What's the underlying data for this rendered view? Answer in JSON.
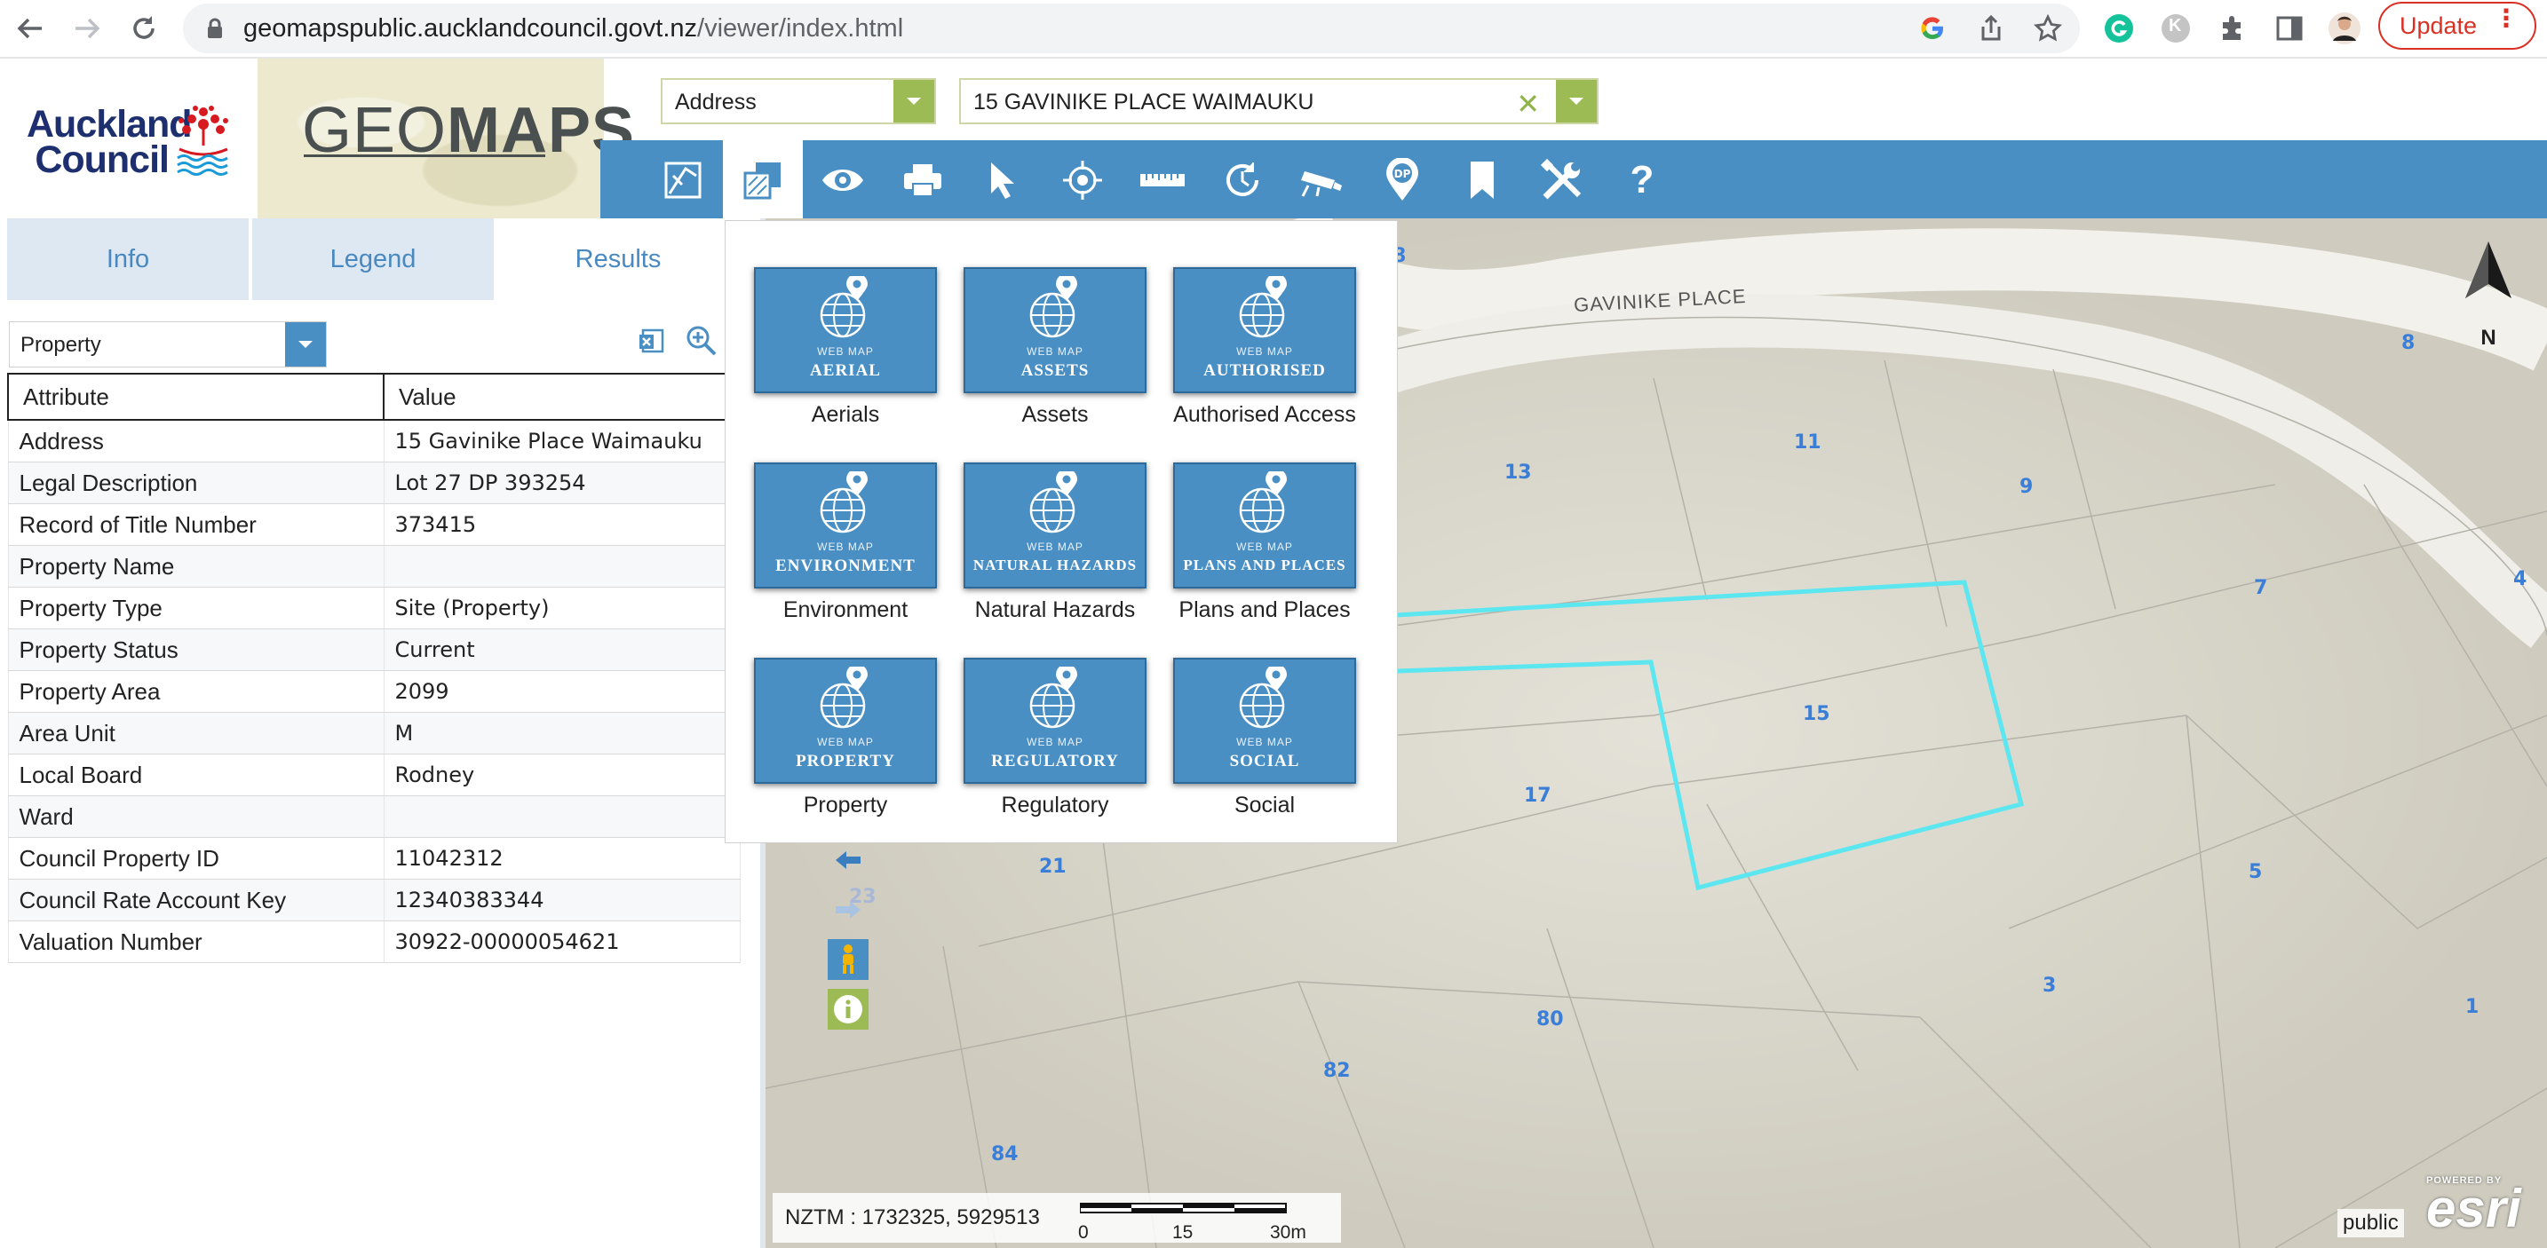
{
  "browser": {
    "url_host": "geomapspublic.aucklandcouncil.govt.nz",
    "url_path": "/viewer/index.html",
    "update_label": "Update",
    "profile_letter": "K"
  },
  "header": {
    "council_name_line1": "Auckland",
    "council_name_line2": "Council",
    "app_title_light": "GEO",
    "app_title_bold": "MAPS",
    "search_type": "Address",
    "search_value": "15 GAVINIKE PLACE WAIMAUKU"
  },
  "toolbar": {
    "tools": [
      "basemap-switch-icon",
      "basemap-gallery-icon",
      "eye-icon",
      "print-icon",
      "select-pointer-icon",
      "locate-icon",
      "measure-ruler-icon",
      "time-history-icon",
      "street-camera-icon",
      "dp-marker-icon",
      "bookmark-icon",
      "tools-icon",
      "help-icon"
    ],
    "help_glyph": "?"
  },
  "panel": {
    "tabs": [
      {
        "label": "Info"
      },
      {
        "label": "Legend"
      },
      {
        "label": "Results"
      }
    ],
    "layer": "Property",
    "table_headers": [
      "Attribute",
      "Value"
    ],
    "rows": [
      {
        "attr": "Address",
        "value": "15 Gavinike Place Waimauku"
      },
      {
        "attr": "Legal Description",
        "value": "Lot 27 DP 393254"
      },
      {
        "attr": "Record of Title Number",
        "value": "373415"
      },
      {
        "attr": "Property Name",
        "value": ""
      },
      {
        "attr": "Property Type",
        "value": "Site (Property)"
      },
      {
        "attr": "Property Status",
        "value": "Current"
      },
      {
        "attr": "Property Area",
        "value": "2099"
      },
      {
        "attr": "Area Unit",
        "value": "M"
      },
      {
        "attr": "Local Board",
        "value": "Rodney"
      },
      {
        "attr": "Ward",
        "value": ""
      },
      {
        "attr": "Council Property ID",
        "value": "11042312"
      },
      {
        "attr": "Council Rate Account Key",
        "value": "12340383344"
      },
      {
        "attr": "Valuation Number",
        "value": "30922-00000054621"
      }
    ]
  },
  "gallery": {
    "web_map_tag": "WEB MAP",
    "items": [
      {
        "category": "AERIAL",
        "label": "Aerials"
      },
      {
        "category": "ASSETS",
        "label": "Assets"
      },
      {
        "category": "AUTHORISED",
        "label": "Authorised Access"
      },
      {
        "category": "ENVIRONMENT",
        "label": "Environment"
      },
      {
        "category": "NATURAL HAZARDS",
        "label": "Natural Hazards"
      },
      {
        "category": "PLANS AND PLACES",
        "label": "Plans and Places"
      },
      {
        "category": "PROPERTY",
        "label": "Property"
      },
      {
        "category": "REGULATORY",
        "label": "Regulatory"
      },
      {
        "category": "SOCIAL",
        "label": "Social"
      }
    ]
  },
  "map": {
    "road_label": "GAVINIKE PLACE",
    "north_label": "N",
    "lot_numbers": [
      "8",
      "13",
      "11",
      "9",
      "8",
      "7",
      "4",
      "15",
      "17",
      "21",
      "23",
      "5",
      "3",
      "80",
      "82",
      "84",
      "1"
    ],
    "coordinates": "NZTM : 1732325, 5929513",
    "scale_labels": [
      "0",
      "15",
      "30m"
    ],
    "public_label": "public",
    "esri_powered": "POWERED BY",
    "esri_word": "esri",
    "highlight_color": "#5ce6f0"
  }
}
